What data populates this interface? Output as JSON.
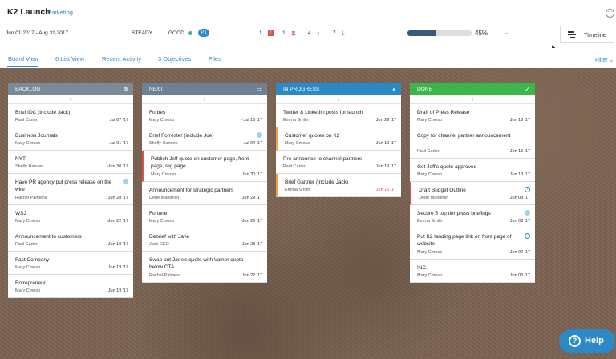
{
  "header": {
    "title": "K2 Launch",
    "tag": "Marketing",
    "more_icon": "more-icon"
  },
  "info": {
    "dates": "Jun 01,2017 - Aug 31,2017",
    "status": "STEADY",
    "health": "GOOD",
    "priority": "P1",
    "counts": [
      "1",
      "1",
      "4",
      "7"
    ],
    "progress_percent": 45,
    "progress_label": "45%"
  },
  "timeline_button": {
    "label": "Timeline"
  },
  "tabs": [
    "Board View",
    "6 List View",
    "Recent Activity",
    "3 Objectives",
    "Files"
  ],
  "filter_label": "Filter",
  "columns": [
    {
      "name": "BACKLOG",
      "color": "#7a8a99",
      "cards": [
        {
          "title": "Brief IDC (include Jack)",
          "person": "Paul Carter",
          "date": "Jul 07 '17"
        },
        {
          "title": "Business Journals",
          "person": "Mary Cmoso",
          "date": "Jul 01 '17"
        },
        {
          "title": "NYT",
          "person": "Shelly Hansen",
          "date": "Jun 30 '17"
        },
        {
          "title": "Have PR agency put press release on the wire",
          "person": "Rachel Palmera",
          "date": "Jun 28 '17"
        },
        {
          "title": "WSJ",
          "person": "Mary Cmoso",
          "date": "Jun 22 '17"
        },
        {
          "title": "Announcement to customers",
          "person": "Paul Carter",
          "date": "Jun 19 '17"
        },
        {
          "title": "Fast Company",
          "person": "Mary Cmoso",
          "date": "Jun 19 '17"
        },
        {
          "title": "Entrepreneur",
          "person": "Mary Cmoso",
          "date": "Jun 19 '17"
        }
      ]
    },
    {
      "name": "NEXT",
      "color": "#6c8196",
      "cards": [
        {
          "title": "Forbes",
          "person": "Mary Cmoso",
          "date": "Jul 10 '17"
        },
        {
          "title": "Brief Forrester (include Joe)",
          "person": "Shelly Hansen",
          "date": "Jul 04 '17"
        },
        {
          "title": "Publish Jeff quote on customer page, front page, reg page",
          "person": "Mary Cmoso",
          "date": "Jun 30 '17"
        },
        {
          "title": "Announcement for strategic partners",
          "person": "Dede Mandrish",
          "date": "Jun 29 '17"
        },
        {
          "title": "Fortune",
          "person": "Mary Cmoso",
          "date": "Jun 26 '17"
        },
        {
          "title": "Debrief with Jane",
          "person": "Jack CEO",
          "date": "Jun 23 '17"
        },
        {
          "title": "Swap out Jane's quote with Vamer quote below CTA",
          "person": "Rachel Palmera",
          "date": "Jun 22 '17"
        }
      ]
    },
    {
      "name": "IN PROGRESS",
      "color": "#2b8ac6",
      "cards": [
        {
          "title": "Twitter & LinkedIn posts for launch",
          "person": "Emma Smith",
          "date": "Jun 29 '17"
        },
        {
          "title": "Customer quotes on K2",
          "person": "Mary Cmoso",
          "date": "Jun 19 '17"
        },
        {
          "title": "Pre-announce to channel partners",
          "person": "Paul Carter",
          "date": "Jun 19 '17"
        },
        {
          "title": "Brief Gartner (include Jack)",
          "person": "Emma Smith",
          "date": "Jun 16 '17"
        }
      ]
    },
    {
      "name": "DONE",
      "color": "#3cb54a",
      "cards": [
        {
          "title": "Draft of Press Release",
          "person": "Mary Cmoso",
          "date": "Jun 16 '17"
        },
        {
          "title": "Copy for channel partner announcement",
          "person": "Paul Carter",
          "date": "Jun 15 '17"
        },
        {
          "title": "Get Jeff's quote approved",
          "person": "Mary Cmoso",
          "date": "Jun 13 '17"
        },
        {
          "title": "Draft Budget Outline",
          "person": "Dede Mandrish",
          "date": "Jun 08 '17"
        },
        {
          "title": "Secure 5 top tier press briefings",
          "person": "Emma Smith",
          "date": "Jun 08 '17"
        },
        {
          "title": "Put K2 landing page link on front page of website",
          "person": "Mary Cmoso",
          "date": "Jun 07 '17"
        },
        {
          "title": "INC.",
          "person": "Mary Cmoso",
          "date": "Jun 05 '17"
        }
      ]
    }
  ],
  "help_label": "Help"
}
